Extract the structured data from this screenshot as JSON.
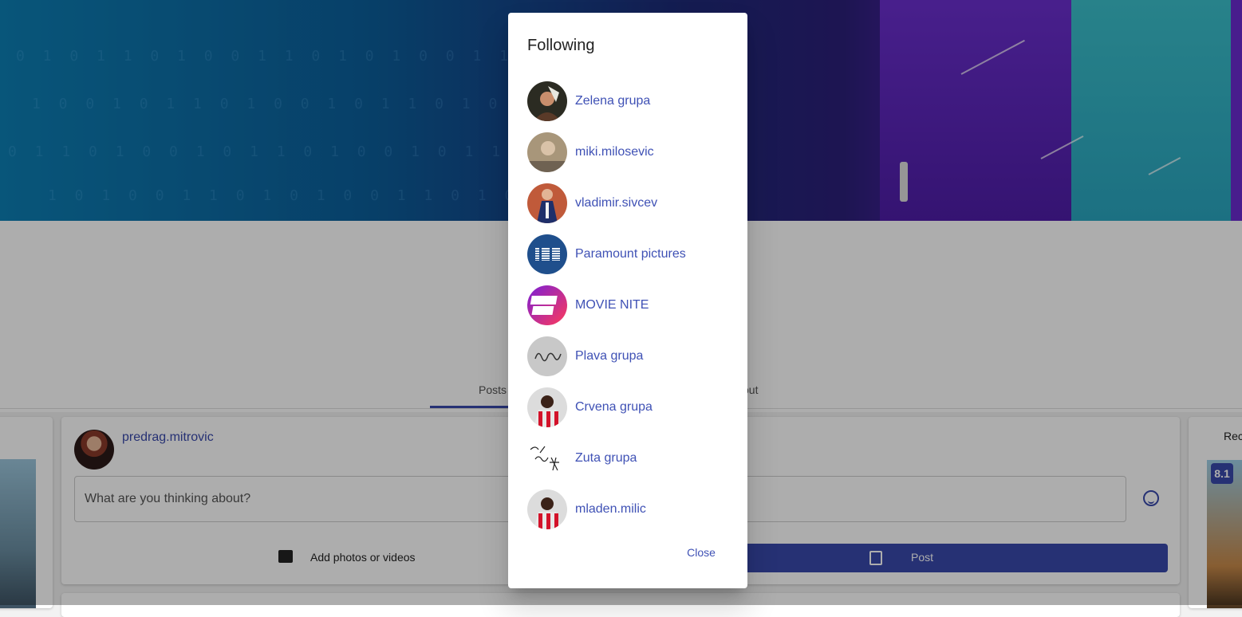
{
  "background": {
    "tabs": [
      "Posts",
      "out"
    ],
    "post_form": {
      "username": "predrag.mitrovic",
      "placeholder": "What are you thinking about?",
      "add_media_label": "Add photos or videos",
      "post_label": "Post"
    },
    "right_panel": {
      "heading": "Rec",
      "score": "8.1"
    }
  },
  "dialog": {
    "title": "Following",
    "items": [
      {
        "name": "Zelena grupa",
        "avatar": "photo"
      },
      {
        "name": "miki.milosevic",
        "avatar": "photo"
      },
      {
        "name": "vladimir.sivcev",
        "avatar": "photo"
      },
      {
        "name": "Paramount pictures",
        "avatar": "IBM"
      },
      {
        "name": "MOVIE NITE",
        "avatar": "MOVIE NITE"
      },
      {
        "name": "Plava grupa",
        "avatar": "signature"
      },
      {
        "name": "Crvena grupa",
        "avatar": "photo"
      },
      {
        "name": "Zuta grupa",
        "avatar": "signature"
      },
      {
        "name": "mladen.milic",
        "avatar": "photo"
      }
    ],
    "close_label": "Close"
  },
  "colors": {
    "accent": "#3f51b5",
    "button": "#3949ab"
  }
}
